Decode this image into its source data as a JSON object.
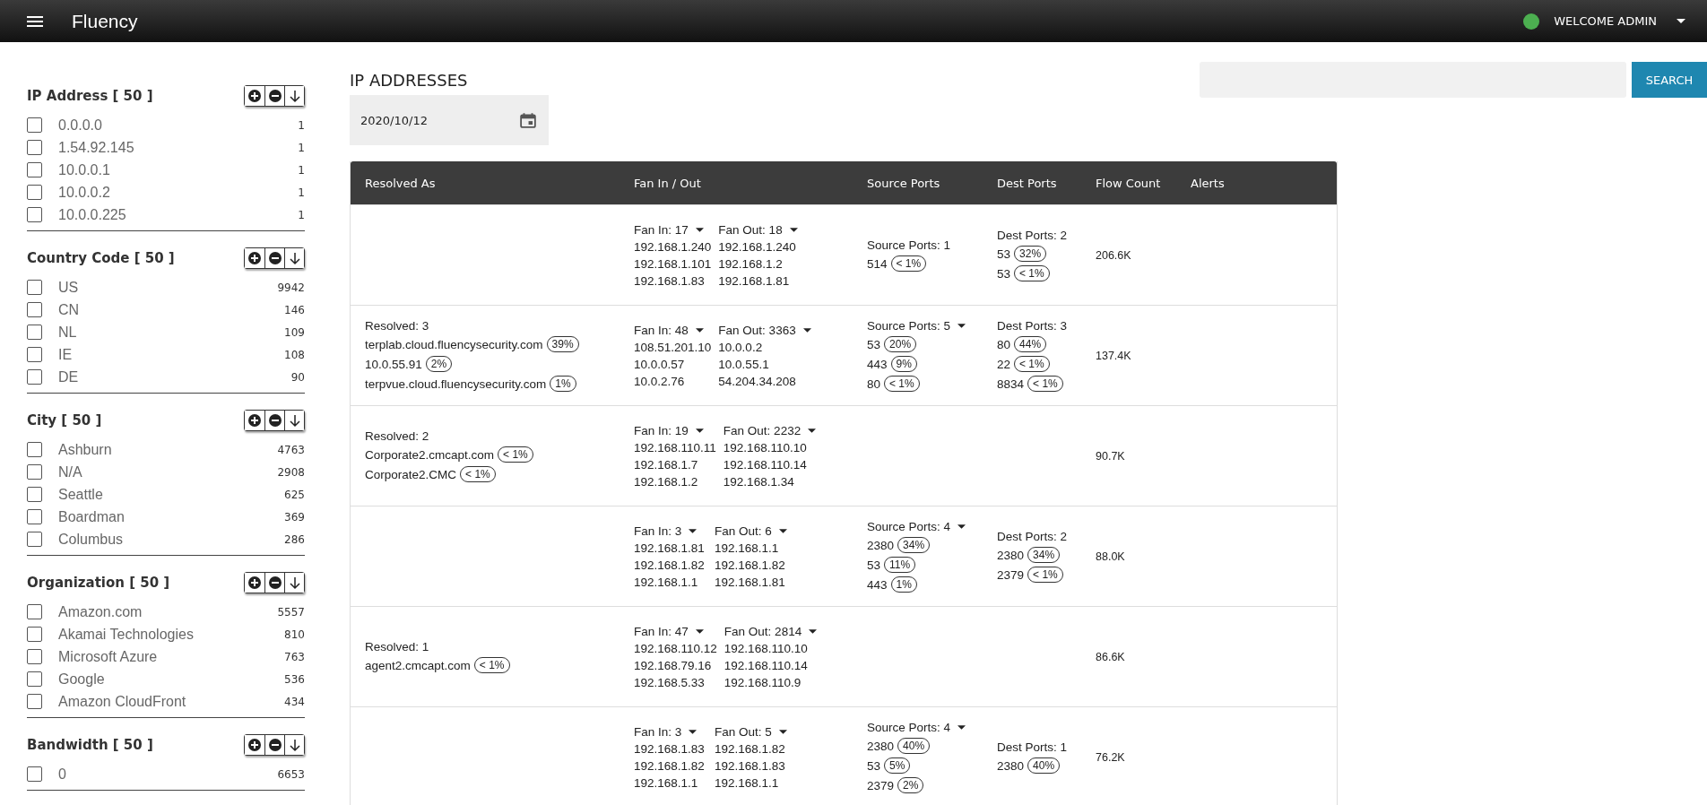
{
  "app_bar": {
    "title": "Fluency",
    "user": "WELCOME ADMIN",
    "online": true
  },
  "filters": [
    {
      "title": "IP Address [ 50 ]",
      "items": [
        {
          "label": "0.0.0.0",
          "count": "1",
          "checked": false
        },
        {
          "label": "1.54.92.145",
          "count": "1",
          "checked": false
        },
        {
          "label": "10.0.0.1",
          "count": "1",
          "checked": false
        },
        {
          "label": "10.0.0.2",
          "count": "1",
          "checked": false
        },
        {
          "label": "10.0.0.225",
          "count": "1",
          "checked": false
        }
      ]
    },
    {
      "title": "Country Code [ 50 ]",
      "items": [
        {
          "label": "US",
          "count": "9942",
          "checked": false
        },
        {
          "label": "CN",
          "count": "146",
          "checked": false
        },
        {
          "label": "NL",
          "count": "109",
          "checked": false
        },
        {
          "label": "IE",
          "count": "108",
          "checked": false
        },
        {
          "label": "DE",
          "count": "90",
          "checked": false
        }
      ]
    },
    {
      "title": "City [ 50 ]",
      "items": [
        {
          "label": "Ashburn",
          "count": "4763",
          "checked": false
        },
        {
          "label": "N/A",
          "count": "2908",
          "checked": false
        },
        {
          "label": "Seattle",
          "count": "625",
          "checked": false
        },
        {
          "label": "Boardman",
          "count": "369",
          "checked": false
        },
        {
          "label": "Columbus",
          "count": "286",
          "checked": false
        }
      ]
    },
    {
      "title": "Organization [ 50 ]",
      "items": [
        {
          "label": "Amazon.com",
          "count": "5557",
          "checked": false
        },
        {
          "label": "Akamai Technologies",
          "count": "810",
          "checked": false
        },
        {
          "label": "Microsoft Azure",
          "count": "763",
          "checked": false
        },
        {
          "label": "Google",
          "count": "536",
          "checked": false
        },
        {
          "label": "Amazon CloudFront",
          "count": "434",
          "checked": false
        }
      ]
    },
    {
      "title": "Bandwidth [ 50 ]",
      "items": [
        {
          "label": "0",
          "count": "6653",
          "checked": false
        }
      ]
    }
  ],
  "page_title": "IP ADDRESSES",
  "date_field": {
    "value": "2020/10/12"
  },
  "search": {
    "button": "SEARCH"
  },
  "table": {
    "columns": [
      "Resolved As",
      "Fan In / Out",
      "Source Ports",
      "Dest Ports",
      "Flow Count",
      "Alerts"
    ],
    "rows": [
      {
        "resolved": null,
        "fan": {
          "in_label": "Fan In: 17",
          "out_label": "Fan Out: 18",
          "in": [
            "192.168.1.240",
            "192.168.1.101",
            "192.168.1.83"
          ],
          "out": [
            "192.168.1.240",
            "192.168.1.2",
            "192.168.1.81"
          ]
        },
        "source_ports": {
          "label": "Source Ports: 1",
          "dropdown": false,
          "items": [
            {
              "port": "514",
              "pct": "< 1%"
            }
          ]
        },
        "dest_ports": {
          "label": "Dest Ports: 2",
          "items": [
            {
              "port": "53",
              "pct": "32%"
            },
            {
              "port": "53",
              "pct": "< 1%"
            }
          ]
        },
        "flow_count": "206.6K"
      },
      {
        "resolved": {
          "label": "Resolved: 3",
          "items": [
            {
              "name": "terplab.cloud.fluencysecurity.com",
              "pct": "39%"
            },
            {
              "name": "10.0.55.91",
              "pct": "2%"
            },
            {
              "name": "terpvue.cloud.fluencysecurity.com",
              "pct": "1%"
            }
          ]
        },
        "fan": {
          "in_label": "Fan In: 48",
          "out_label": "Fan Out: 3363",
          "in": [
            "108.51.201.10",
            "10.0.0.57",
            "10.0.2.76"
          ],
          "out": [
            "10.0.0.2",
            "10.0.55.1",
            "54.204.34.208"
          ]
        },
        "source_ports": {
          "label": "Source Ports: 5",
          "dropdown": true,
          "items": [
            {
              "port": "53",
              "pct": "20%"
            },
            {
              "port": "443",
              "pct": "9%"
            },
            {
              "port": "80",
              "pct": "< 1%"
            }
          ]
        },
        "dest_ports": {
          "label": "Dest Ports: 3",
          "items": [
            {
              "port": "80",
              "pct": "44%"
            },
            {
              "port": "22",
              "pct": "< 1%"
            },
            {
              "port": "8834",
              "pct": "< 1%"
            }
          ]
        },
        "flow_count": "137.4K"
      },
      {
        "resolved": {
          "label": "Resolved: 2",
          "items": [
            {
              "name": "Corporate2.cmcapt.com",
              "pct": "< 1%"
            },
            {
              "name": "Corporate2.CMC",
              "pct": "< 1%"
            }
          ]
        },
        "fan": {
          "in_label": "Fan In: 19",
          "out_label": "Fan Out: 2232",
          "in": [
            "192.168.110.11",
            "192.168.1.7",
            "192.168.1.2"
          ],
          "out": [
            "192.168.110.10",
            "192.168.110.14",
            "192.168.1.34"
          ]
        },
        "source_ports": null,
        "dest_ports": null,
        "flow_count": "90.7K"
      },
      {
        "resolved": null,
        "fan": {
          "in_label": "Fan In: 3",
          "out_label": "Fan Out: 6",
          "in": [
            "192.168.1.81",
            "192.168.1.82",
            "192.168.1.1"
          ],
          "out": [
            "192.168.1.1",
            "192.168.1.82",
            "192.168.1.81"
          ]
        },
        "source_ports": {
          "label": "Source Ports: 4",
          "dropdown": true,
          "items": [
            {
              "port": "2380",
              "pct": "34%"
            },
            {
              "port": "53",
              "pct": "11%"
            },
            {
              "port": "443",
              "pct": "1%"
            }
          ]
        },
        "dest_ports": {
          "label": "Dest Ports: 2",
          "items": [
            {
              "port": "2380",
              "pct": "34%"
            },
            {
              "port": "2379",
              "pct": "< 1%"
            }
          ]
        },
        "flow_count": "88.0K"
      },
      {
        "resolved": {
          "label": "Resolved: 1",
          "items": [
            {
              "name": "agent2.cmcapt.com",
              "pct": "< 1%"
            }
          ]
        },
        "fan": {
          "in_label": "Fan In: 47",
          "out_label": "Fan Out: 2814",
          "in": [
            "192.168.110.12",
            "192.168.79.16",
            "192.168.5.33"
          ],
          "out": [
            "192.168.110.10",
            "192.168.110.14",
            "192.168.110.9"
          ]
        },
        "source_ports": null,
        "dest_ports": null,
        "flow_count": "86.6K"
      },
      {
        "resolved": null,
        "fan": {
          "in_label": "Fan In: 3",
          "out_label": "Fan Out: 5",
          "in": [
            "192.168.1.83",
            "192.168.1.82",
            "192.168.1.1"
          ],
          "out": [
            "192.168.1.82",
            "192.168.1.83",
            "192.168.1.1"
          ]
        },
        "source_ports": {
          "label": "Source Ports: 4",
          "dropdown": true,
          "items": [
            {
              "port": "2380",
              "pct": "40%"
            },
            {
              "port": "53",
              "pct": "5%"
            },
            {
              "port": "2379",
              "pct": "2%"
            }
          ]
        },
        "dest_ports": {
          "label": "Dest Ports: 1",
          "items": [
            {
              "port": "2380",
              "pct": "40%"
            }
          ]
        },
        "flow_count": "76.2K"
      }
    ]
  }
}
